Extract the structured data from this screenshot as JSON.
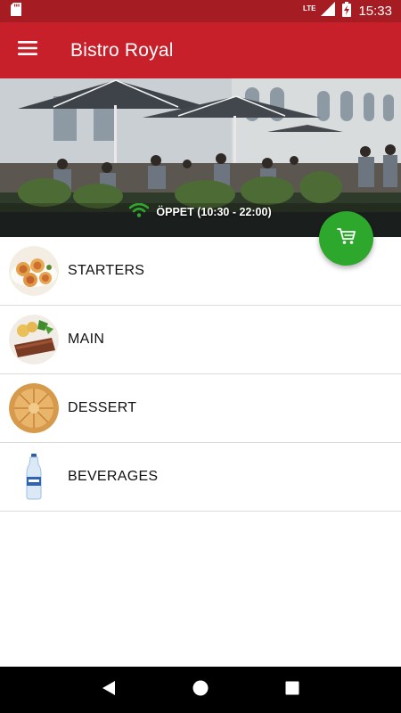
{
  "status_bar": {
    "time": "15:33",
    "network": "LTE",
    "icons": [
      "sd-card-icon",
      "signal-icon",
      "battery-charging-icon"
    ]
  },
  "app_bar": {
    "title": "Bistro Royal",
    "menu_icon": "menu-icon"
  },
  "hero": {
    "open_status": "ÖPPET (10:30 - 22:00)",
    "status_icon": "wifi-icon",
    "status_icon_color": "#2ea82c"
  },
  "cart_button": {
    "icon": "cart-icon",
    "color": "#2ea82c"
  },
  "categories": [
    {
      "label": "STARTERS",
      "icon": "starters-thumbnail"
    },
    {
      "label": "MAIN",
      "icon": "main-thumbnail"
    },
    {
      "label": "DESSERT",
      "icon": "dessert-thumbnail"
    },
    {
      "label": "BEVERAGES",
      "icon": "beverages-thumbnail"
    }
  ],
  "nav_bar": {
    "icons": [
      "back-icon",
      "home-icon",
      "recents-icon"
    ]
  },
  "colors": {
    "app_bar": "#c8202a",
    "status_bar": "#a51d22",
    "accent": "#2ea82c"
  }
}
